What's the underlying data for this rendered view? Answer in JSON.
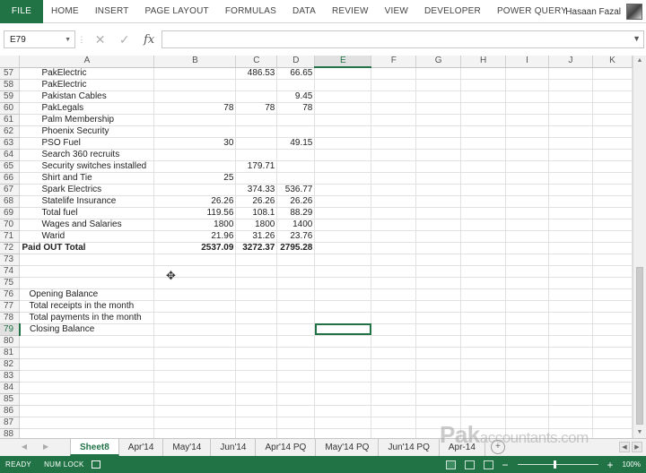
{
  "ribbon": {
    "file": "FILE",
    "tabs": [
      "HOME",
      "INSERT",
      "PAGE LAYOUT",
      "FORMULAS",
      "DATA",
      "REVIEW",
      "VIEW",
      "DEVELOPER",
      "POWER QUERY"
    ],
    "user_name": "Hasaan Fazal"
  },
  "formula_bar": {
    "name_box": "E79",
    "formula": ""
  },
  "columns": [
    "A",
    "B",
    "C",
    "D",
    "E",
    "F",
    "G",
    "H",
    "I",
    "J",
    "K"
  ],
  "rows": [
    {
      "n": "57",
      "a": "PakElectric",
      "b": "",
      "c": "486.53",
      "d": "66.65"
    },
    {
      "n": "58",
      "a": "PakElectric",
      "b": "",
      "c": "",
      "d": ""
    },
    {
      "n": "59",
      "a": "Pakistan Cables",
      "b": "",
      "c": "",
      "d": "9.45"
    },
    {
      "n": "60",
      "a": "PakLegals",
      "b": "78",
      "c": "78",
      "d": "78"
    },
    {
      "n": "61",
      "a": "Palm Membership",
      "b": "",
      "c": "",
      "d": ""
    },
    {
      "n": "62",
      "a": "Phoenix Security",
      "b": "",
      "c": "",
      "d": ""
    },
    {
      "n": "63",
      "a": "PSO Fuel",
      "b": "30",
      "c": "",
      "d": "49.15"
    },
    {
      "n": "64",
      "a": "Search 360 recruits",
      "b": "",
      "c": "",
      "d": ""
    },
    {
      "n": "65",
      "a": "Security switches installed",
      "b": "",
      "c": "179.71",
      "d": ""
    },
    {
      "n": "66",
      "a": "Shirt and Tie",
      "b": "25",
      "c": "",
      "d": ""
    },
    {
      "n": "67",
      "a": "Spark Electrics",
      "b": "",
      "c": "374.33",
      "d": "536.77"
    },
    {
      "n": "68",
      "a": "Statelife Insurance",
      "b": "26.26",
      "c": "26.26",
      "d": "26.26"
    },
    {
      "n": "69",
      "a": "Total fuel",
      "b": "119.56",
      "c": "108.1",
      "d": "88.29"
    },
    {
      "n": "70",
      "a": "Wages and Salaries",
      "b": "1800",
      "c": "1800",
      "d": "1400"
    },
    {
      "n": "71",
      "a": "Warid",
      "b": "21.96",
      "c": "31.26",
      "d": "23.76"
    },
    {
      "n": "72",
      "a": "Paid OUT Total",
      "b": "2537.09",
      "c": "3272.37",
      "d": "2795.28"
    },
    {
      "n": "73",
      "a": "",
      "b": "",
      "c": "",
      "d": ""
    },
    {
      "n": "74",
      "a": "",
      "b": "",
      "c": "",
      "d": ""
    },
    {
      "n": "75",
      "a": "",
      "b": "",
      "c": "",
      "d": ""
    },
    {
      "n": "76",
      "a": "Opening Balance",
      "b": "",
      "c": "",
      "d": ""
    },
    {
      "n": "77",
      "a": "Total receipts in the month",
      "b": "",
      "c": "",
      "d": ""
    },
    {
      "n": "78",
      "a": "Total payments in the month",
      "b": "",
      "c": "",
      "d": ""
    },
    {
      "n": "79",
      "a": "Closing Balance",
      "b": "",
      "c": "",
      "d": ""
    },
    {
      "n": "80",
      "a": "",
      "b": "",
      "c": "",
      "d": ""
    },
    {
      "n": "81",
      "a": "",
      "b": "",
      "c": "",
      "d": ""
    },
    {
      "n": "82",
      "a": "",
      "b": "",
      "c": "",
      "d": ""
    },
    {
      "n": "83",
      "a": "",
      "b": "",
      "c": "",
      "d": ""
    },
    {
      "n": "84",
      "a": "",
      "b": "",
      "c": "",
      "d": ""
    },
    {
      "n": "85",
      "a": "",
      "b": "",
      "c": "",
      "d": ""
    },
    {
      "n": "86",
      "a": "",
      "b": "",
      "c": "",
      "d": ""
    },
    {
      "n": "87",
      "a": "",
      "b": "",
      "c": "",
      "d": ""
    },
    {
      "n": "88",
      "a": "",
      "b": "",
      "c": "",
      "d": ""
    }
  ],
  "sheet_tabs": [
    "Sheet8",
    "Apr'14",
    "May'14",
    "Jun'14",
    "Apr'14 PQ",
    "May'14 PQ",
    "Jun'14 PQ",
    "Apr-14"
  ],
  "add_sheet": "+",
  "watermark": {
    "big": "Pak",
    "small": "accountants.com"
  },
  "status": {
    "ready": "READY",
    "numlock": "NUM LOCK",
    "zoom": "100%"
  },
  "icons": [
    "dropdown-arrow-icon",
    "cancel-icon",
    "check-icon",
    "fx-icon",
    "expand-icon",
    "macro-record-icon",
    "normal-view-icon",
    "page-layout-icon",
    "page-break-icon",
    "zoom-minus-icon",
    "zoom-plus-icon"
  ],
  "colors": {
    "accent": "#217346"
  }
}
